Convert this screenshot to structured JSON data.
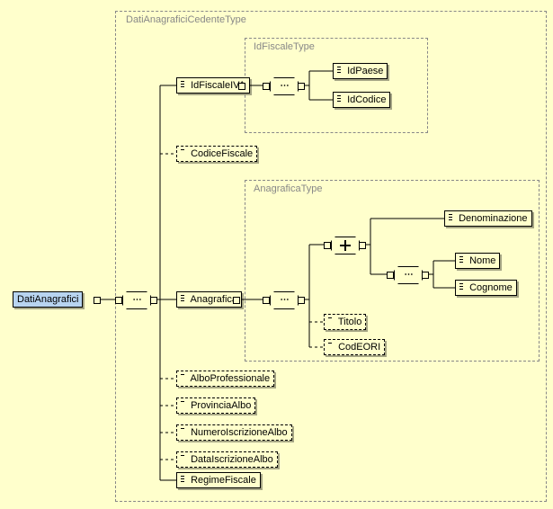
{
  "diagram": {
    "rootGroup": {
      "label": "DatiAnagraficiCedenteType"
    },
    "root": {
      "label": "DatiAnagrafici"
    },
    "children": {
      "idFiscaleIVA": {
        "label": "IdFiscaleIVA",
        "group": "IdFiscaleType",
        "children": {
          "idPaese": "IdPaese",
          "idCodice": "IdCodice"
        }
      },
      "codiceFiscale": "CodiceFiscale",
      "anagrafica": {
        "label": "Anagrafica",
        "group": "AnagraficaType",
        "choice": {
          "denominazione": "Denominazione",
          "seq": {
            "nome": "Nome",
            "cognome": "Cognome"
          }
        },
        "optional": {
          "titolo": "Titolo",
          "codEORI": "CodEORI"
        }
      },
      "alboProfessionale": "AlboProfessionale",
      "provinciaAlbo": "ProvinciaAlbo",
      "numeroIscrizioneAlbo": "NumeroIscrizioneAlbo",
      "dataIscrizioneAlbo": "DataIscrizioneAlbo",
      "regimeFiscale": "RegimeFiscale"
    }
  }
}
